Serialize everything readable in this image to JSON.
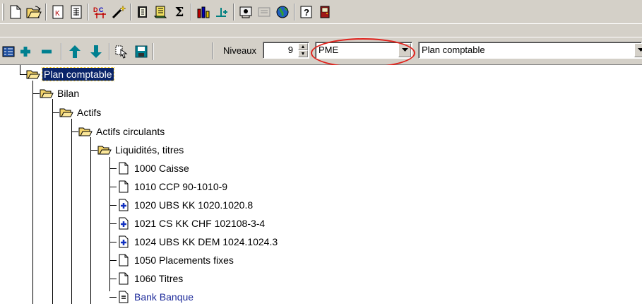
{
  "toolbar_top": {
    "icons": [
      "new-document-icon",
      "open-folder-icon",
      "k-document-icon",
      "table-icon",
      "compare-icon",
      "magic-wand-icon",
      "book-icon",
      "scroll-icon",
      "sigma-icon",
      "chart-icon",
      "add-row-icon",
      "helpdesk-icon",
      "disabled-icon",
      "globe-icon",
      "help-icon",
      "exit-door-icon"
    ],
    "sigma": "Σ",
    "help": "?"
  },
  "toolbar_tree": {
    "niveaux_label": "Niveaux",
    "niveaux_value": "9",
    "plan_selector_value": "PME",
    "plan_name_value": "Plan comptable"
  },
  "tree": {
    "root": "Plan comptable",
    "bilan": "Bilan",
    "actifs": "Actifs",
    "actifs_circulants": "Actifs circulants",
    "liquidites": "Liquidités, titres",
    "accounts": [
      {
        "label": "1000 Caisse",
        "icon": "document-icon"
      },
      {
        "label": "1010 CCP 90-1010-9",
        "icon": "document-icon"
      },
      {
        "label": "1020 UBS KK 1020.1020.8",
        "icon": "bank-account-icon"
      },
      {
        "label": "1021 CS KK CHF 102108-3-4",
        "icon": "bank-account-icon"
      },
      {
        "label": "1024 UBS KK DEM 1024.1024.3",
        "icon": "bank-account-icon"
      },
      {
        "label": "1050 Placements fixes",
        "icon": "document-icon"
      },
      {
        "label": "1060 Titres",
        "icon": "document-icon"
      },
      {
        "label": "Bank Banque",
        "icon": "group-total-icon"
      }
    ]
  },
  "colors": {
    "toolbar_bg": "#d4d0c8",
    "selection_bg": "#0a246a",
    "highlight_ring": "#e0221c",
    "link_text": "#1d2a9a"
  }
}
